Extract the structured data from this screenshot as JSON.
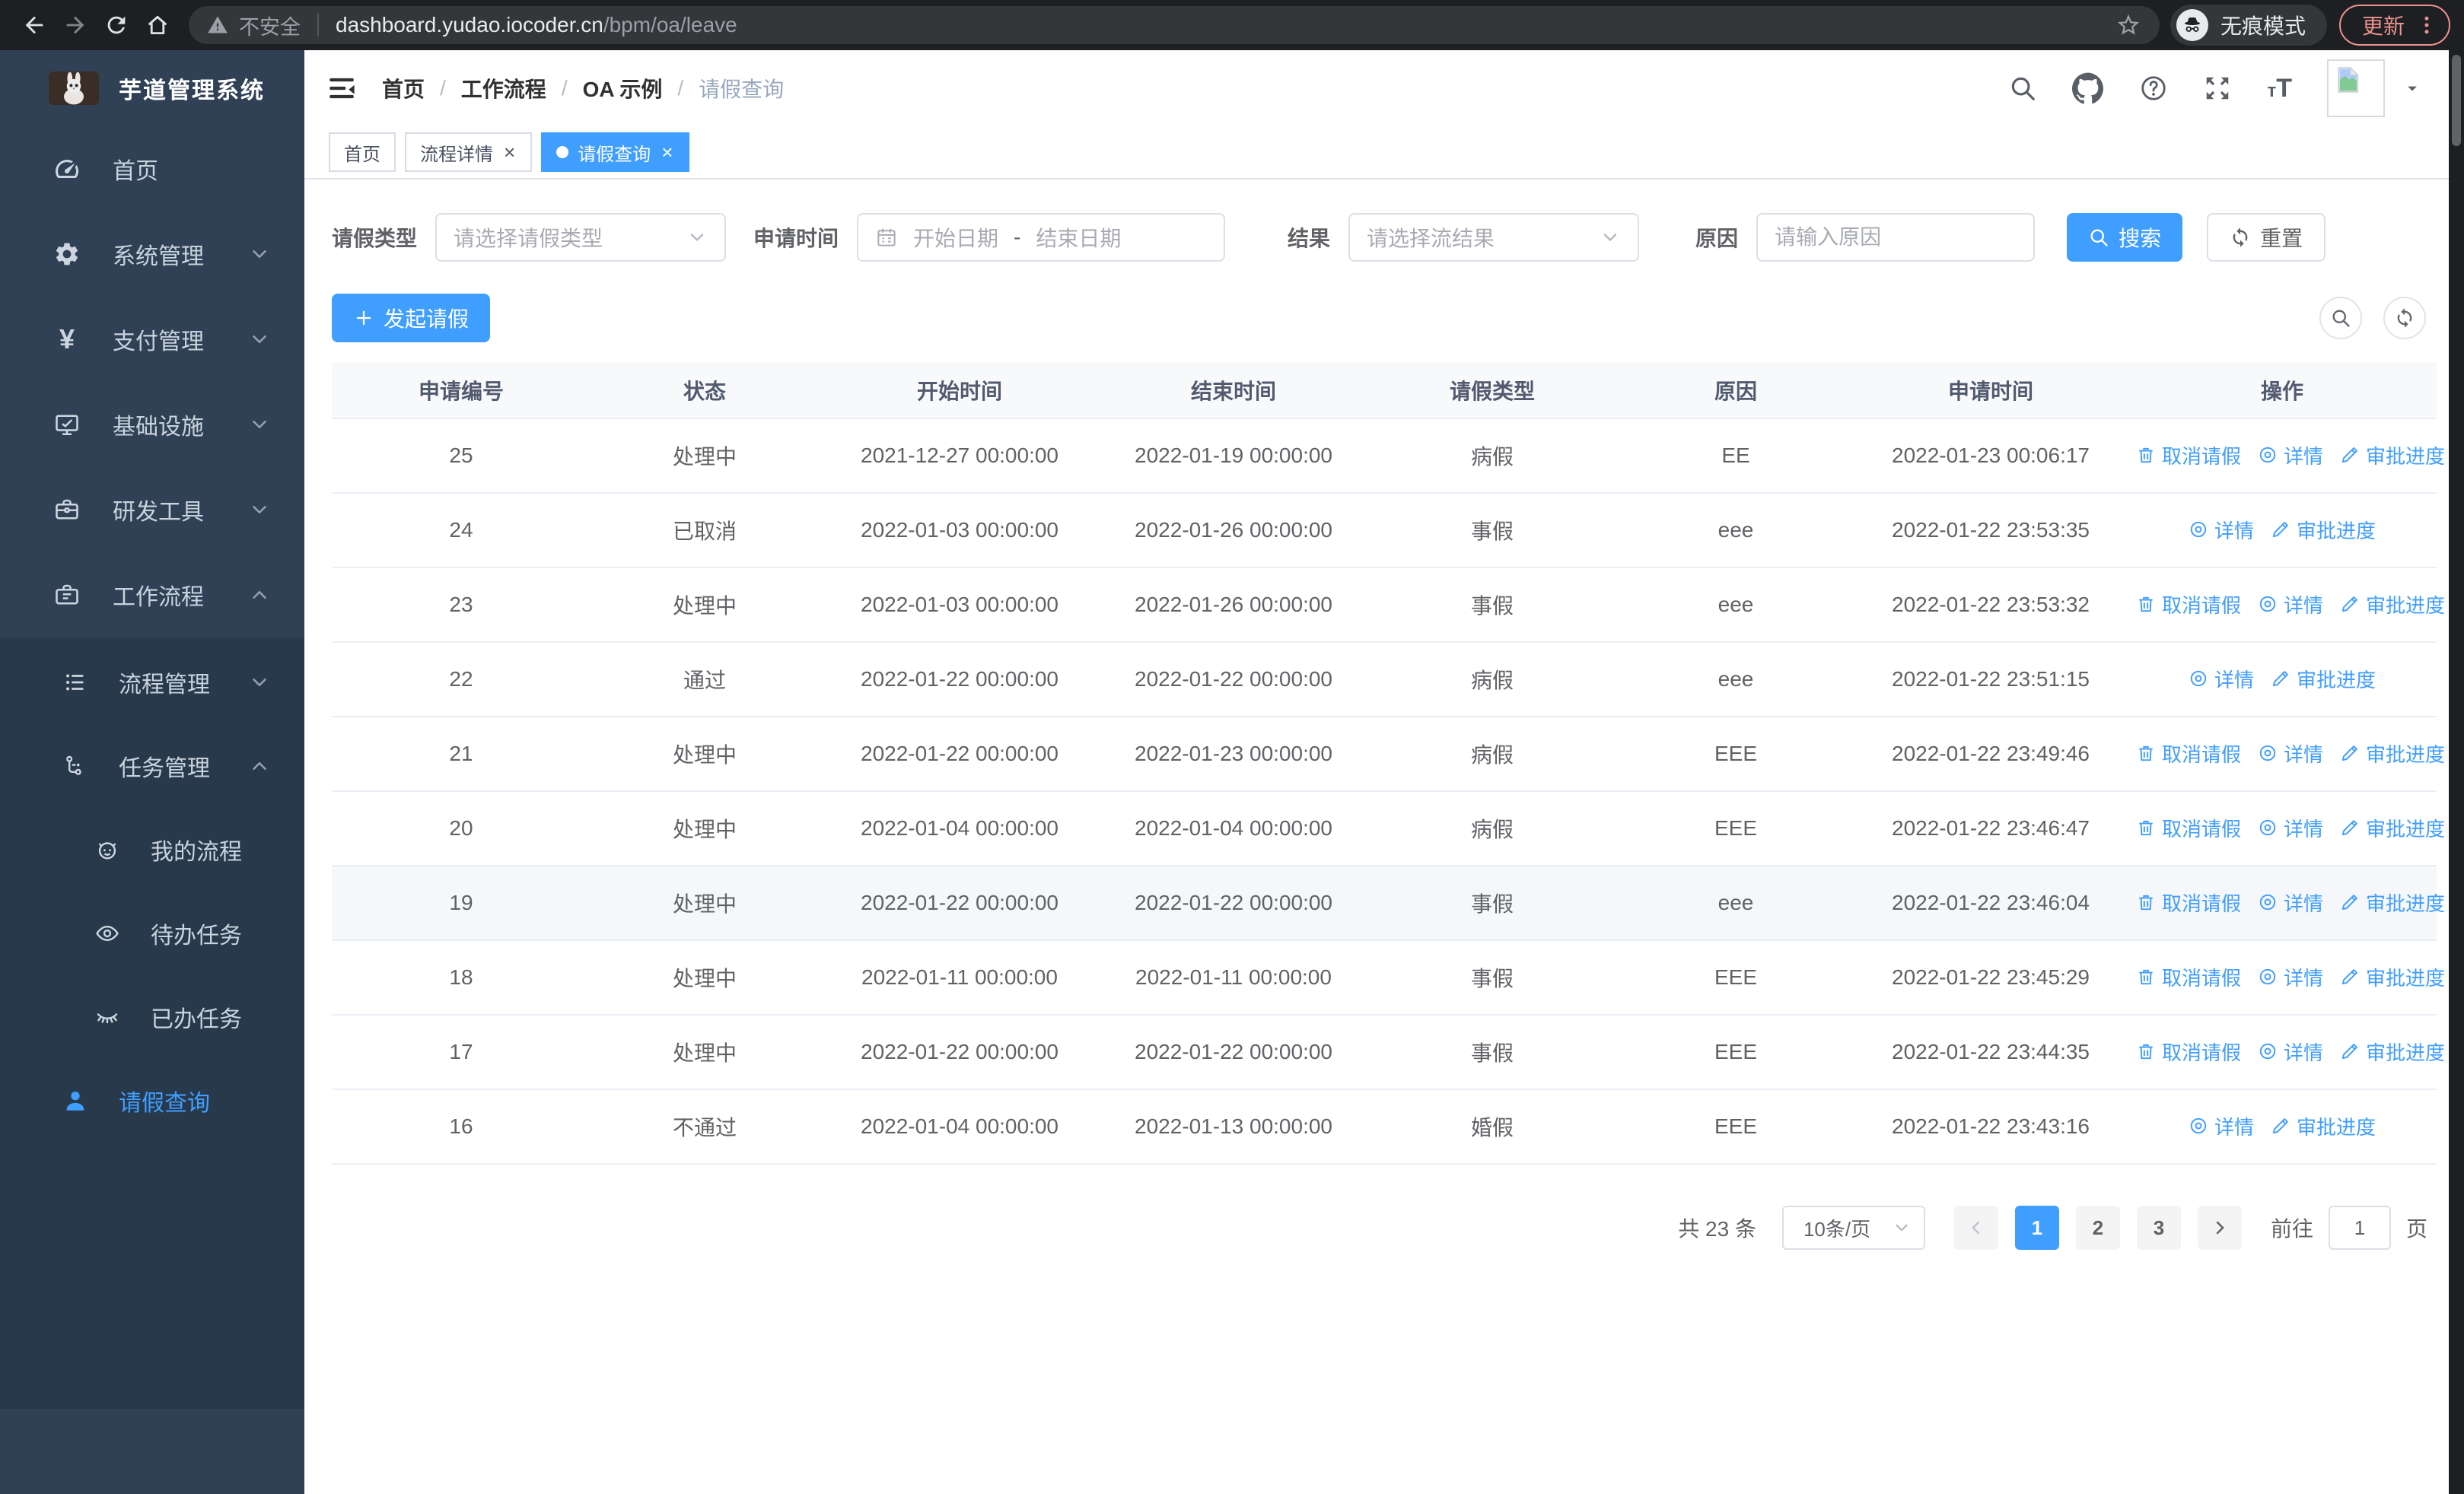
{
  "browser": {
    "security_warning": "不安全",
    "url_domain": "dashboard.yudao.iocoder.cn",
    "url_path": "/bpm/oa/leave",
    "incognito_label": "无痕模式",
    "update_label": "更新"
  },
  "sidebar": {
    "app_title": "芋道管理系统",
    "menu": [
      {
        "label": "首页",
        "icon": "dashboard-icon"
      },
      {
        "label": "系统管理",
        "icon": "gear-icon",
        "arrow": "down"
      },
      {
        "label": "支付管理",
        "icon": "yen-icon",
        "arrow": "down"
      },
      {
        "label": "基础设施",
        "icon": "monitor-icon",
        "arrow": "down"
      },
      {
        "label": "研发工具",
        "icon": "toolbox-icon",
        "arrow": "down"
      },
      {
        "label": "工作流程",
        "icon": "briefcase-icon",
        "arrow": "up"
      }
    ],
    "submenu": [
      {
        "label": "流程管理",
        "icon": "list-icon",
        "arrow": "down",
        "level": 1
      },
      {
        "label": "任务管理",
        "icon": "branch-icon",
        "arrow": "up",
        "level": 1
      },
      {
        "label": "我的流程",
        "icon": "face-icon",
        "level": 2
      },
      {
        "label": "待办任务",
        "icon": "eye-icon",
        "level": 2
      },
      {
        "label": "已办任务",
        "icon": "eye-closed-icon",
        "level": 2
      },
      {
        "label": "请假查询",
        "icon": "user-icon",
        "level": 1,
        "active": true
      }
    ]
  },
  "breadcrumb": {
    "items": [
      "首页",
      "工作流程",
      "OA 示例",
      "请假查询"
    ],
    "separator": "/"
  },
  "tabs": [
    {
      "label": "首页"
    },
    {
      "label": "流程详情",
      "closable": true
    },
    {
      "label": "请假查询",
      "closable": true,
      "active": true
    }
  ],
  "filters": {
    "leave_type": {
      "label": "请假类型",
      "placeholder": "请选择请假类型"
    },
    "apply_time": {
      "label": "申请时间",
      "start_placeholder": "开始日期",
      "separator": "-",
      "end_placeholder": "结束日期"
    },
    "result": {
      "label": "结果",
      "placeholder": "请选择流结果"
    },
    "reason": {
      "label": "原因",
      "placeholder": "请输入原因"
    },
    "search_label": "搜索",
    "reset_label": "重置"
  },
  "toolbar": {
    "create_label": "发起请假"
  },
  "table": {
    "columns": [
      "申请编号",
      "状态",
      "开始时间",
      "结束时间",
      "请假类型",
      "原因",
      "申请时间",
      "操作"
    ],
    "action_labels": {
      "cancel": "取消请假",
      "detail": "详情",
      "progress": "审批进度"
    },
    "rows": [
      {
        "id": "25",
        "status": "处理中",
        "start_time": "2021-12-27 00:00:00",
        "end_time": "2022-01-19 00:00:00",
        "leave_type": "病假",
        "reason": "EE",
        "apply_time": "2022-01-23 00:06:17",
        "can_cancel": true,
        "highlighted": false
      },
      {
        "id": "24",
        "status": "已取消",
        "start_time": "2022-01-03 00:00:00",
        "end_time": "2022-01-26 00:00:00",
        "leave_type": "事假",
        "reason": "eee",
        "apply_time": "2022-01-22 23:53:35",
        "can_cancel": false,
        "highlighted": false
      },
      {
        "id": "23",
        "status": "处理中",
        "start_time": "2022-01-03 00:00:00",
        "end_time": "2022-01-26 00:00:00",
        "leave_type": "事假",
        "reason": "eee",
        "apply_time": "2022-01-22 23:53:32",
        "can_cancel": true,
        "highlighted": false
      },
      {
        "id": "22",
        "status": "通过",
        "start_time": "2022-01-22 00:00:00",
        "end_time": "2022-01-22 00:00:00",
        "leave_type": "病假",
        "reason": "eee",
        "apply_time": "2022-01-22 23:51:15",
        "can_cancel": false,
        "highlighted": false
      },
      {
        "id": "21",
        "status": "处理中",
        "start_time": "2022-01-22 00:00:00",
        "end_time": "2022-01-23 00:00:00",
        "leave_type": "病假",
        "reason": "EEE",
        "apply_time": "2022-01-22 23:49:46",
        "can_cancel": true,
        "highlighted": false
      },
      {
        "id": "20",
        "status": "处理中",
        "start_time": "2022-01-04 00:00:00",
        "end_time": "2022-01-04 00:00:00",
        "leave_type": "病假",
        "reason": "EEE",
        "apply_time": "2022-01-22 23:46:47",
        "can_cancel": true,
        "highlighted": false
      },
      {
        "id": "19",
        "status": "处理中",
        "start_time": "2022-01-22 00:00:00",
        "end_time": "2022-01-22 00:00:00",
        "leave_type": "事假",
        "reason": "eee",
        "apply_time": "2022-01-22 23:46:04",
        "can_cancel": true,
        "highlighted": true
      },
      {
        "id": "18",
        "status": "处理中",
        "start_time": "2022-01-11 00:00:00",
        "end_time": "2022-01-11 00:00:00",
        "leave_type": "事假",
        "reason": "EEE",
        "apply_time": "2022-01-22 23:45:29",
        "can_cancel": true,
        "highlighted": false
      },
      {
        "id": "17",
        "status": "处理中",
        "start_time": "2022-01-22 00:00:00",
        "end_time": "2022-01-22 00:00:00",
        "leave_type": "事假",
        "reason": "EEE",
        "apply_time": "2022-01-22 23:44:35",
        "can_cancel": true,
        "highlighted": false
      },
      {
        "id": "16",
        "status": "不通过",
        "start_time": "2022-01-04 00:00:00",
        "end_time": "2022-01-13 00:00:00",
        "leave_type": "婚假",
        "reason": "EEE",
        "apply_time": "2022-01-22 23:43:16",
        "can_cancel": false,
        "highlighted": false
      }
    ]
  },
  "pagination": {
    "total": "共 23 条",
    "page_size": "10条/页",
    "pages": [
      "1",
      "2",
      "3"
    ],
    "active_page": "1",
    "goto_label": "前往",
    "goto_value": "1",
    "unit_label": "页"
  },
  "colors": {
    "accent": "#409eff",
    "sidebar_bg": "#304156",
    "submenu_bg": "#28394b",
    "chrome_bg": "#1e1f22",
    "update_accent": "#ec928e"
  }
}
